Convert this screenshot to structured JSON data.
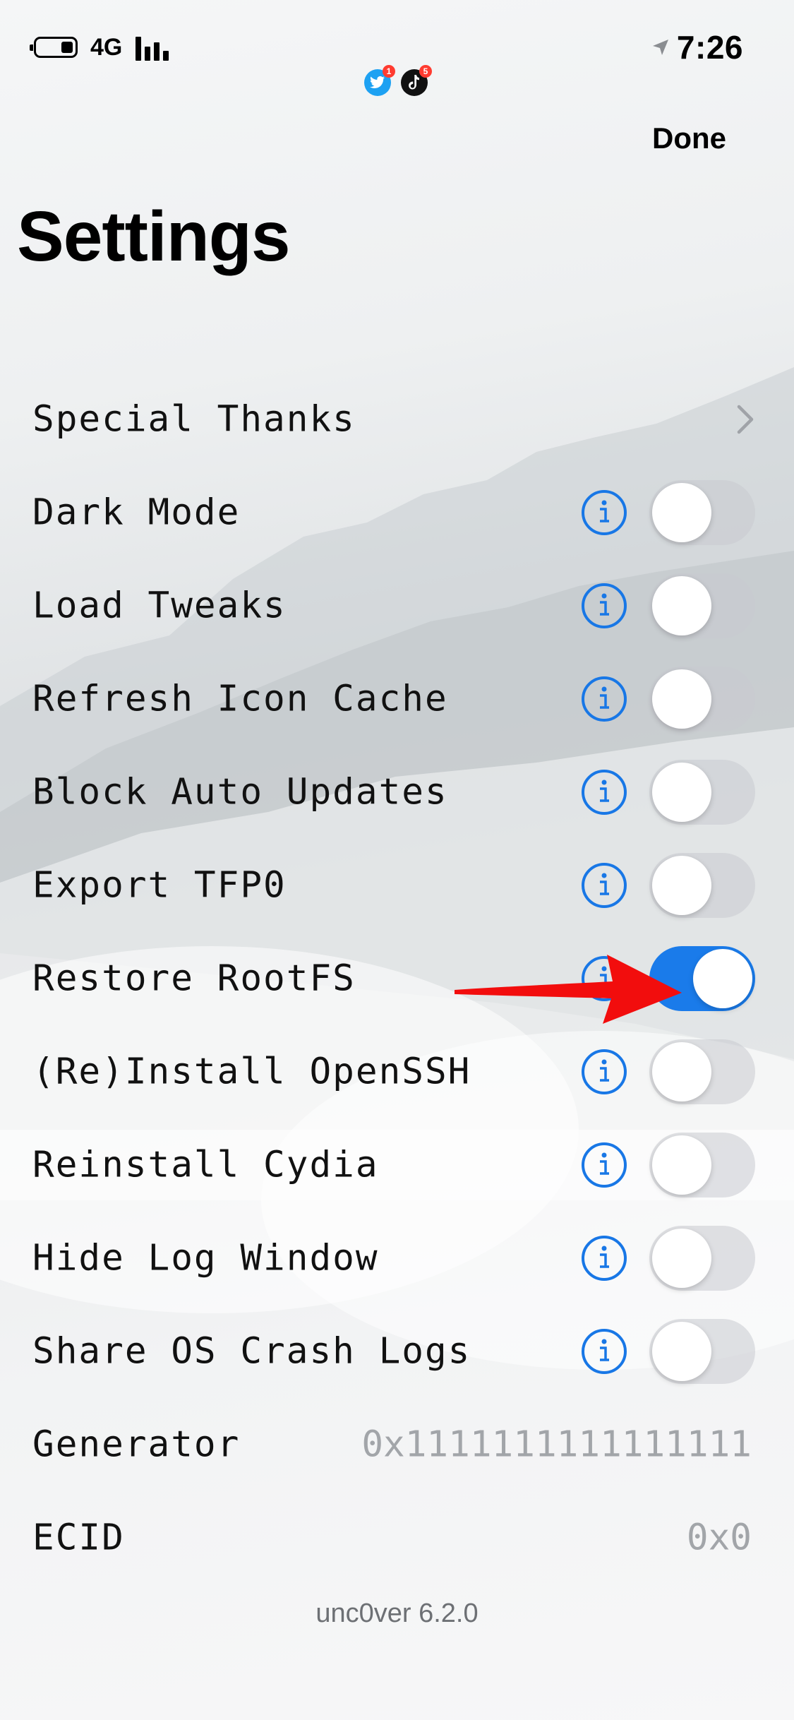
{
  "status_bar": {
    "network": "4G",
    "time": "7:26",
    "notifications": [
      {
        "icon": "twitter-icon",
        "badge": "1",
        "color": "#1da1f2"
      },
      {
        "icon": "tiktok-icon",
        "badge": "5",
        "color": "#111111"
      }
    ]
  },
  "nav": {
    "done_label": "Done"
  },
  "page": {
    "title": "Settings"
  },
  "settings": {
    "special_thanks": {
      "label": "Special Thanks",
      "icon": "chevron-right-icon"
    },
    "toggles": [
      {
        "label": "Dark Mode",
        "on": false
      },
      {
        "label": "Load Tweaks",
        "on": false
      },
      {
        "label": "Refresh Icon Cache",
        "on": false
      },
      {
        "label": "Block Auto Updates",
        "on": false
      },
      {
        "label": "Export TFP0",
        "on": false
      },
      {
        "label": "Restore RootFS",
        "on": true
      },
      {
        "label": "(Re)Install OpenSSH",
        "on": false
      },
      {
        "label": "Reinstall Cydia",
        "on": false
      },
      {
        "label": "Hide Log Window",
        "on": false
      },
      {
        "label": "Share OS Crash Logs",
        "on": false
      }
    ],
    "generator": {
      "label": "Generator",
      "value": "0x1111111111111111"
    },
    "ecid": {
      "label": "ECID",
      "value": "0x0"
    }
  },
  "footer": {
    "version": "unc0ver 6.2.0"
  },
  "colors": {
    "accent": "#1a7bea",
    "info_icon": "#1877e6",
    "annotation_arrow": "#f20d0d"
  }
}
